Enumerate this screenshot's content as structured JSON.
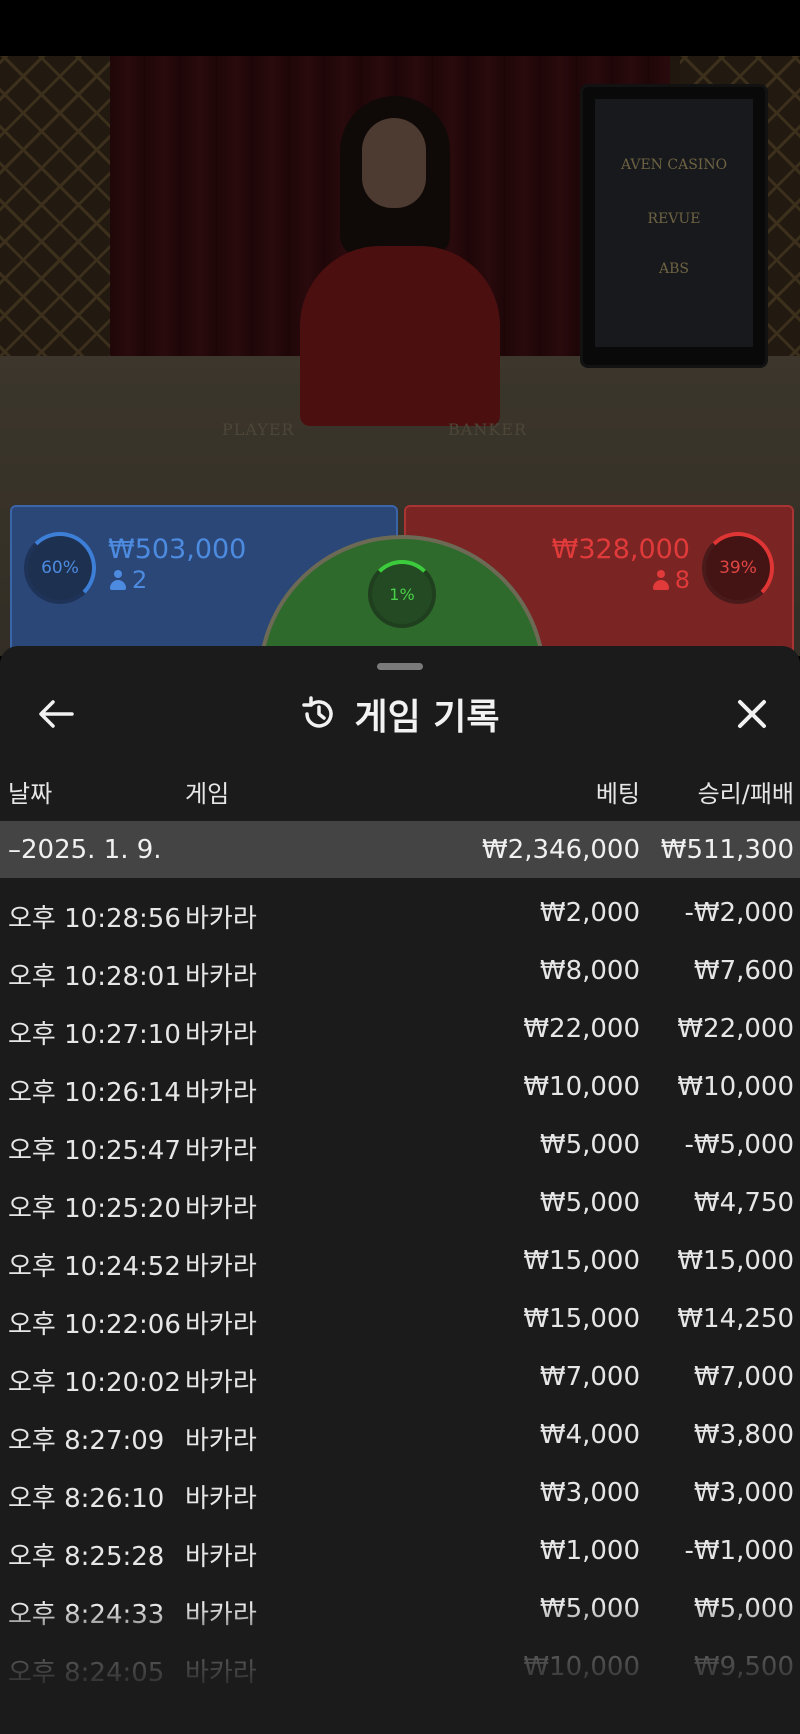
{
  "stream": {
    "felt_labels": [
      "PLAYER",
      "BANKER"
    ],
    "screen_logos": [
      "AVEN CASINO",
      "REVUE",
      "ABS"
    ]
  },
  "betting": {
    "player": {
      "percent": "60%",
      "amount": "₩503,000",
      "count": "2",
      "color": "#4d8be0"
    },
    "tie": {
      "percent": "1%",
      "color": "#49d049"
    },
    "banker": {
      "percent": "39%",
      "amount": "₩328,000",
      "count": "8",
      "color": "#e03a3a"
    }
  },
  "history": {
    "title": "게임 기록",
    "icons": {
      "back": "arrow-left-icon",
      "history": "history-clock-icon",
      "close": "close-icon"
    },
    "columns": {
      "date": "날짜",
      "game": "게임",
      "bet": "베팅",
      "win_loss": "승리/패배"
    },
    "day": {
      "date": "–2025. 1. 9.",
      "bet": "₩2,346,000",
      "win_loss": "₩511,300"
    },
    "rows": [
      {
        "time": "오후 10:28:56",
        "game": "바카라",
        "bet": "₩2,000",
        "win_loss": "-₩2,000"
      },
      {
        "time": "오후 10:28:01",
        "game": "바카라",
        "bet": "₩8,000",
        "win_loss": "₩7,600"
      },
      {
        "time": "오후 10:27:10",
        "game": "바카라",
        "bet": "₩22,000",
        "win_loss": "₩22,000"
      },
      {
        "time": "오후 10:26:14",
        "game": "바카라",
        "bet": "₩10,000",
        "win_loss": "₩10,000"
      },
      {
        "time": "오후 10:25:47",
        "game": "바카라",
        "bet": "₩5,000",
        "win_loss": "-₩5,000"
      },
      {
        "time": "오후 10:25:20",
        "game": "바카라",
        "bet": "₩5,000",
        "win_loss": "₩4,750"
      },
      {
        "time": "오후 10:24:52",
        "game": "바카라",
        "bet": "₩15,000",
        "win_loss": "₩15,000"
      },
      {
        "time": "오후 10:22:06",
        "game": "바카라",
        "bet": "₩15,000",
        "win_loss": "₩14,250"
      },
      {
        "time": "오후 10:20:02",
        "game": "바카라",
        "bet": "₩7,000",
        "win_loss": "₩7,000"
      },
      {
        "time": "오후 8:27:09",
        "game": "바카라",
        "bet": "₩4,000",
        "win_loss": "₩3,800"
      },
      {
        "time": "오후 8:26:10",
        "game": "바카라",
        "bet": "₩3,000",
        "win_loss": "₩3,000"
      },
      {
        "time": "오후 8:25:28",
        "game": "바카라",
        "bet": "₩1,000",
        "win_loss": "-₩1,000"
      },
      {
        "time": "오후 8:24:33",
        "game": "바카라",
        "bet": "₩5,000",
        "win_loss": "₩5,000"
      },
      {
        "time": "오후 8:24:05",
        "game": "바카라",
        "bet": "₩10,000",
        "win_loss": "₩9,500"
      }
    ]
  }
}
